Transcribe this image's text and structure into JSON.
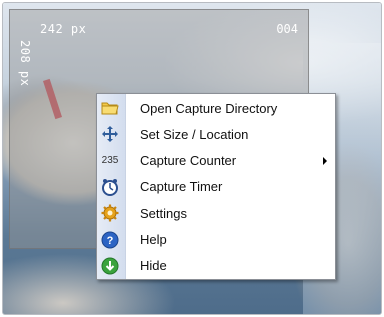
{
  "capture": {
    "width_label": "242 px",
    "height_label": "208 px",
    "counter": "004"
  },
  "menu": {
    "items": [
      {
        "label": "Open Capture Directory",
        "icon": "folder-icon",
        "submenu": false
      },
      {
        "label": "Set Size / Location",
        "icon": "move-icon",
        "submenu": false
      },
      {
        "label": "Capture Counter",
        "icon": "counter-icon",
        "icon_text": "235",
        "submenu": true
      },
      {
        "label": "Capture Timer",
        "icon": "timer-icon",
        "submenu": false
      },
      {
        "label": "Settings",
        "icon": "gear-icon",
        "submenu": false
      },
      {
        "label": "Help",
        "icon": "help-icon",
        "submenu": false
      },
      {
        "label": "Hide",
        "icon": "hide-icon",
        "submenu": false
      }
    ]
  },
  "colors": {
    "menu_border": "#8b8f96",
    "gutter": "#dbe3f1",
    "overlay": "#969696"
  }
}
